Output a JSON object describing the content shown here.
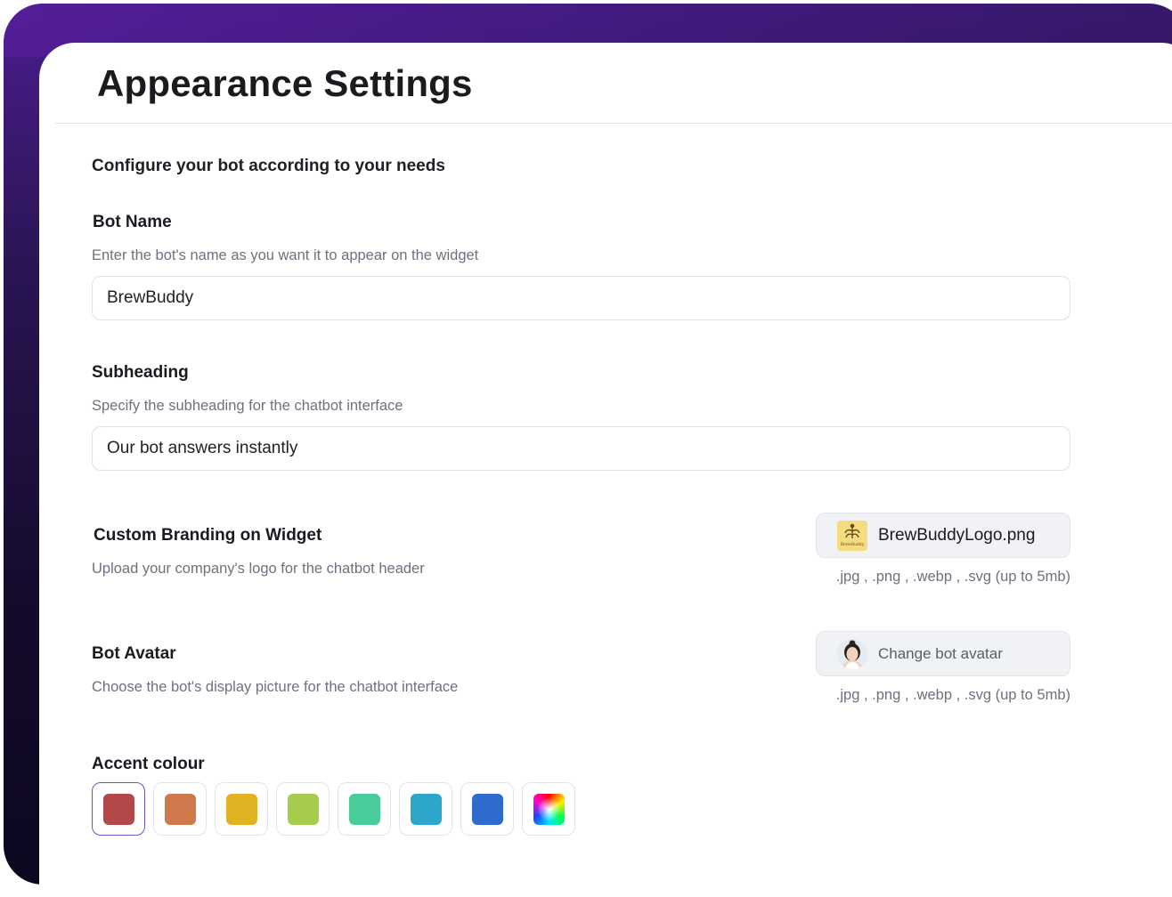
{
  "page": {
    "title": "Appearance Settings",
    "intro": "Configure your bot according to your needs"
  },
  "bot_name": {
    "label": "Bot Name",
    "description": "Enter the bot's name as you want it to appear on the widget",
    "value": "BrewBuddy"
  },
  "subheading": {
    "label": "Subheading",
    "description": "Specify the subheading for the chatbot interface",
    "value": "Our bot answers instantly"
  },
  "branding": {
    "label": "Custom Branding on Widget",
    "description": "Upload your company's logo for the chatbot header",
    "file_name": "BrewBuddyLogo.png",
    "formats_hint": ".jpg , .png , .webp , .svg (up to 5mb)",
    "logo_text": "BrewBuddy"
  },
  "avatar": {
    "label": "Bot Avatar",
    "description": "Choose the bot's display picture for the chatbot interface",
    "button_label": "Change bot avatar",
    "formats_hint": ".jpg , .png , .webp , .svg (up to 5mb)"
  },
  "accent": {
    "label": "Accent colour",
    "colors": [
      "#b34848",
      "#cf7a4c",
      "#e0b324",
      "#a5cc4a",
      "#49cc99",
      "#2ea6cc",
      "#2e6bcc",
      "custom-gradient"
    ],
    "selected": 0
  }
}
